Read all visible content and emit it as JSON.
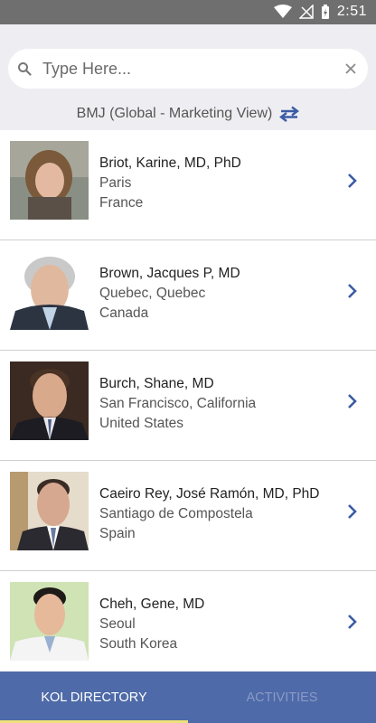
{
  "status_bar": {
    "time": "2:51"
  },
  "search": {
    "placeholder": "Type Here..."
  },
  "source": {
    "label": "BMJ (Global - Marketing View)"
  },
  "people": [
    {
      "name": "Briot, Karine, MD, PhD",
      "line2": "Paris",
      "line3": "France"
    },
    {
      "name": "Brown, Jacques P, MD",
      "line2": "Quebec, Quebec",
      "line3": "Canada"
    },
    {
      "name": "Burch, Shane, MD",
      "line2": "San Francisco, California",
      "line3": "United States"
    },
    {
      "name": "Caeiro Rey, José Ramón, MD, PhD",
      "line2": "Santiago de Compostela",
      "line3": "Spain"
    },
    {
      "name": "Cheh, Gene, MD",
      "line2": "Seoul",
      "line3": "South Korea"
    }
  ],
  "tabs": {
    "directory": "KOL DIRECTORY",
    "activities": "ACTIVITIES"
  },
  "colors": {
    "accent": "#4e6aa8",
    "link": "#3b5ba5",
    "indicator": "#f0e07a"
  }
}
